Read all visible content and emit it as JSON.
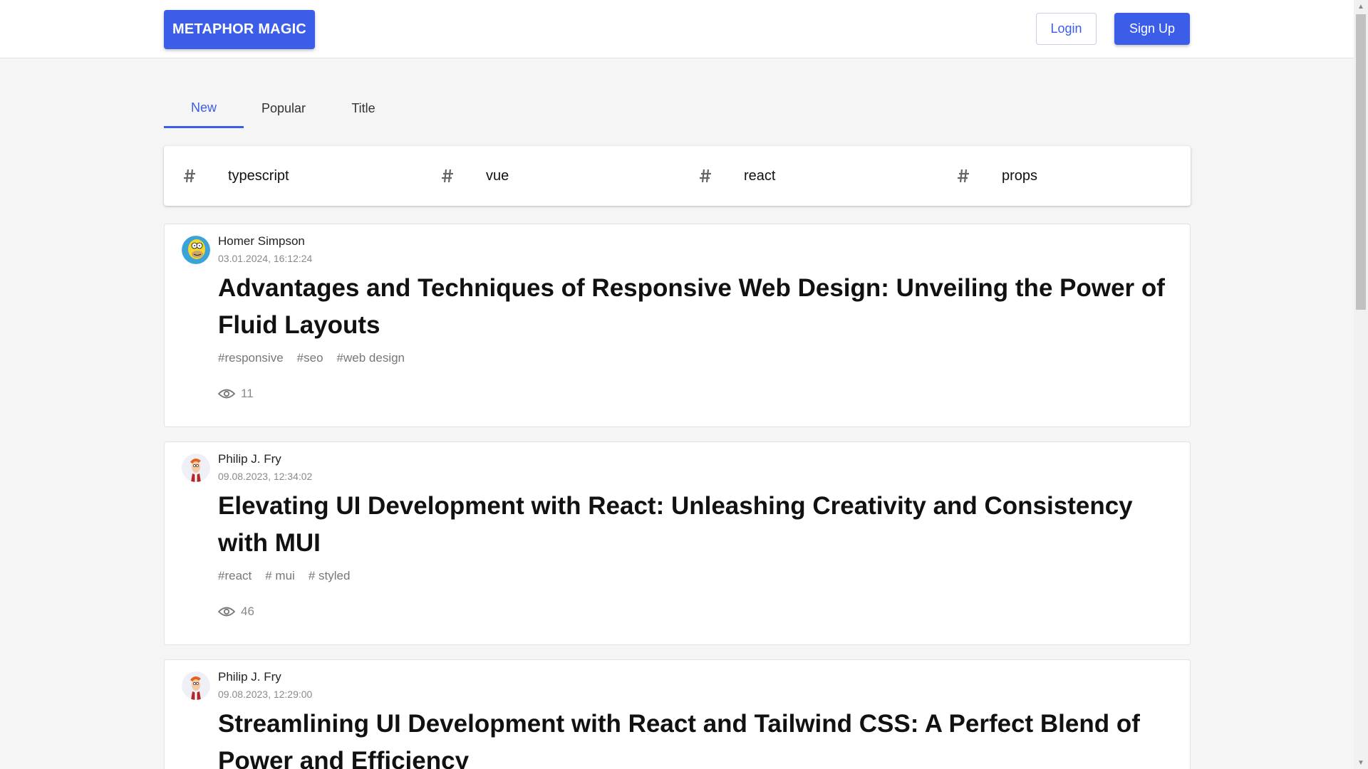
{
  "header": {
    "logo": "METAPHOR MAGIC",
    "login_label": "Login",
    "signup_label": "Sign Up"
  },
  "tabs": [
    {
      "label": "New",
      "active": true
    },
    {
      "label": "Popular",
      "active": false
    },
    {
      "label": "Title",
      "active": false
    }
  ],
  "popular_tags": [
    {
      "icon": "hash-icon",
      "label": "typescript"
    },
    {
      "icon": "hash-icon",
      "label": "vue"
    },
    {
      "icon": "hash-icon",
      "label": "react"
    },
    {
      "icon": "hash-icon",
      "label": "props"
    }
  ],
  "posts": [
    {
      "author": "Homer Simpson",
      "date": "03.01.2024, 16:12:24",
      "title": "Advantages and Techniques of Responsive Web Design: Unveiling the Power of Fluid Layouts",
      "tags": [
        "#responsive",
        "#seo",
        "#web design"
      ],
      "views": "11",
      "avatar": "homer-avatar"
    },
    {
      "author": "Philip J. Fry",
      "date": "09.08.2023, 12:34:02",
      "title": "Elevating UI Development with React: Unleashing Creativity and Consistency with MUI",
      "tags": [
        "#react",
        "# mui",
        "# styled"
      ],
      "views": "46",
      "avatar": "fry-avatar"
    },
    {
      "author": "Philip J. Fry",
      "date": "09.08.2023, 12:29:00",
      "title": "Streamlining UI Development with React and Tailwind CSS: A Perfect Blend of Power and Efficiency",
      "tags": [],
      "views": "",
      "avatar": "fry-avatar"
    }
  ],
  "colors": {
    "accent": "#3b5de7",
    "background": "#f5f5f5",
    "card": "#ffffff"
  }
}
